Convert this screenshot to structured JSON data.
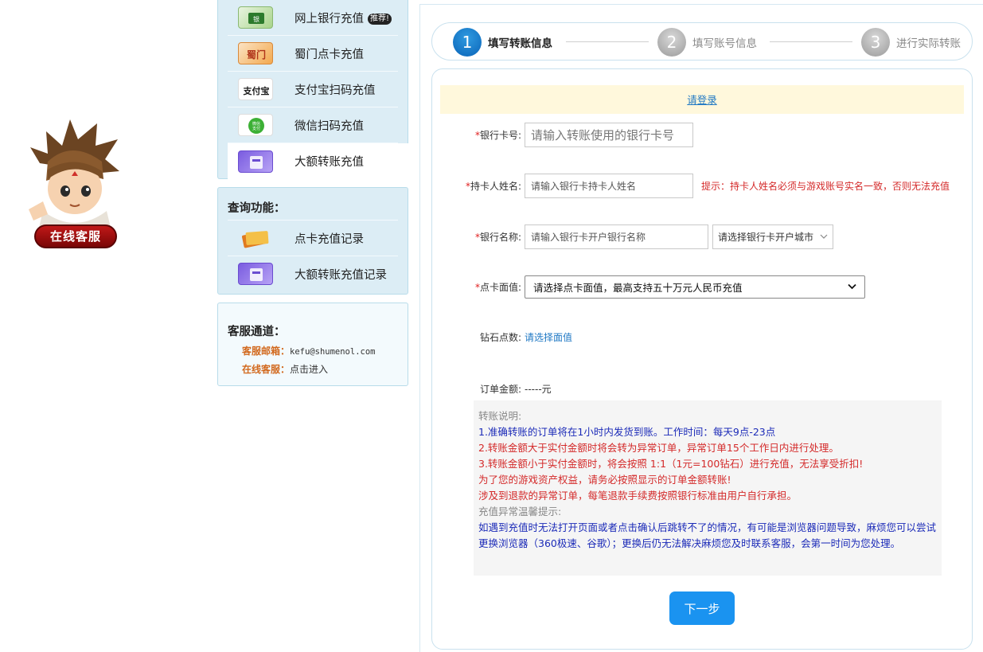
{
  "kefu_badge": "在线客服",
  "menu": [
    {
      "label": "网上银行充值",
      "tag": "推荐!",
      "icon": "bank-card-icon"
    },
    {
      "label": "蜀门点卡充值",
      "icon": "shumen-card-icon"
    },
    {
      "label": "支付宝扫码充值",
      "icon": "alipay-icon"
    },
    {
      "label": "微信扫码充值",
      "icon": "wechat-pay-icon"
    },
    {
      "label": "大额转账充值",
      "icon": "transfer-card-icon"
    }
  ],
  "query": {
    "title": "查询功能：",
    "items": [
      {
        "label": "点卡充值记录",
        "icon": "card-record-icon"
      },
      {
        "label": "大额转账充值记录",
        "icon": "transfer-record-icon"
      }
    ]
  },
  "service": {
    "title": "客服通道：",
    "email_label": "客服邮箱：",
    "email": "kefu@shumenol.com",
    "online_label": "在线客服：",
    "online_link": "点击进入"
  },
  "steps": [
    {
      "num": "1",
      "label": "填写转账信息"
    },
    {
      "num": "2",
      "label": "填写账号信息"
    },
    {
      "num": "3",
      "label": "进行实际转账"
    }
  ],
  "form": {
    "login_link": "请登录",
    "card_no": {
      "label": "银行卡号:",
      "placeholder": "请输入转账使用的银行卡号"
    },
    "holder": {
      "label": "持卡人姓名:",
      "placeholder": "请输入银行卡持卡人姓名",
      "hint": "提示：持卡人姓名必须与游戏账号实名一致，否则无法充值"
    },
    "bank": {
      "label": "银行名称:",
      "placeholder": "请输入银行卡开户银行名称",
      "city_select": "请选择银行卡开户城市"
    },
    "amount": {
      "label": "点卡面值:",
      "select": "请选择点卡面值，最高支持五十万元人民币充值"
    },
    "diamond": {
      "label": "钻石点数:",
      "value": "请选择面值"
    },
    "order": {
      "label": "订单金额:",
      "value": "-----元"
    },
    "required_mark": "*",
    "next_button": "下一步"
  },
  "notes": {
    "title": "转账说明:",
    "lines": [
      "1.准确转账的订单将在1小时内发货到账。工作时间：每天9点-23点",
      "2.转账金额大于实付金额时将会转为异常订单，异常订单15个工作日内进行处理。",
      "3.转账金额小于实付金额时，将会按照 1:1（1元=100钻石）进行充值，无法享受折扣!",
      "为了您的游戏资产权益，请务必按照显示的订单金额转账!",
      "涉及到退款的异常订单，每笔退款手续费按照银行标准由用户自行承担。"
    ],
    "tips_title": "充值异常温馨提示:",
    "tips_text": "如遇到充值时无法打开页面或者点击确认后跳转不了的情况，有可能是浏览器问题导致，麻烦您可以尝试更换浏览器（360极速、谷歌）；更换后仍无法解决麻烦您及时联系客服，会第一时间为您处理。"
  }
}
